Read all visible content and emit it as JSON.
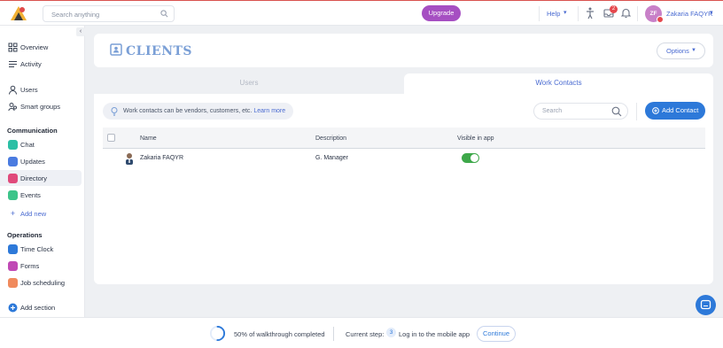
{
  "topbar": {
    "search_placeholder": "Search anything",
    "upgrade_label": "Upgrade",
    "help_label": "Help",
    "notification_count": "2",
    "user_initials": "ZF",
    "user_name": "Zakaria FAQYR"
  },
  "sidebar": {
    "main_items": [
      {
        "label": "Overview",
        "icon": "grid-icon"
      },
      {
        "label": "Activity",
        "icon": "list-icon"
      },
      {
        "label": "Users",
        "icon": "user-icon"
      },
      {
        "label": "Smart groups",
        "icon": "users-icon"
      }
    ],
    "communication_heading": "Communication",
    "communication_items": [
      {
        "label": "Chat",
        "icon": "chat-icon",
        "color": "#2bbfa5"
      },
      {
        "label": "Updates",
        "icon": "updates-icon",
        "color": "#4a7be0"
      },
      {
        "label": "Directory",
        "icon": "directory-icon",
        "color": "#e04a7b",
        "active": true
      },
      {
        "label": "Events",
        "icon": "events-icon",
        "color": "#3dc48a"
      }
    ],
    "add_new_label": "Add new",
    "operations_heading": "Operations",
    "operations_items": [
      {
        "label": "Time Clock",
        "icon": "clock-icon",
        "color": "#2d79d9"
      },
      {
        "label": "Forms",
        "icon": "forms-icon",
        "color": "#c04ab5"
      },
      {
        "label": "Job scheduling",
        "icon": "schedule-icon",
        "color": "#f08a5d"
      }
    ],
    "add_section_label": "Add section"
  },
  "page": {
    "title": "CLIENTS",
    "options_label": "Options"
  },
  "tabs": [
    {
      "label": "Users",
      "active": false
    },
    {
      "label": "Work Contacts",
      "active": true
    }
  ],
  "contacts": {
    "tip_text": "Work contacts can be vendors, customers, etc.",
    "tip_link": "Learn more",
    "search_placeholder": "Search",
    "add_contact_label": "Add Contact",
    "columns": [
      "Name",
      "Description",
      "Visible in app"
    ],
    "rows": [
      {
        "name": "Zakaria FAQYR",
        "description": "G. Manager",
        "visible_in_app": true
      }
    ]
  },
  "walkthrough": {
    "progress_text": "50% of walkthrough completed",
    "progress_fraction": 0.5,
    "current_step_label": "Current step:",
    "step_number": "3",
    "step_text": "Log in to the mobile app",
    "continue_label": "Continue"
  },
  "colors": {
    "accent": "#2d79d9",
    "upgrade": "#a64fc2",
    "toggle_on": "#3ea84a",
    "title": "#7a9fd6"
  }
}
